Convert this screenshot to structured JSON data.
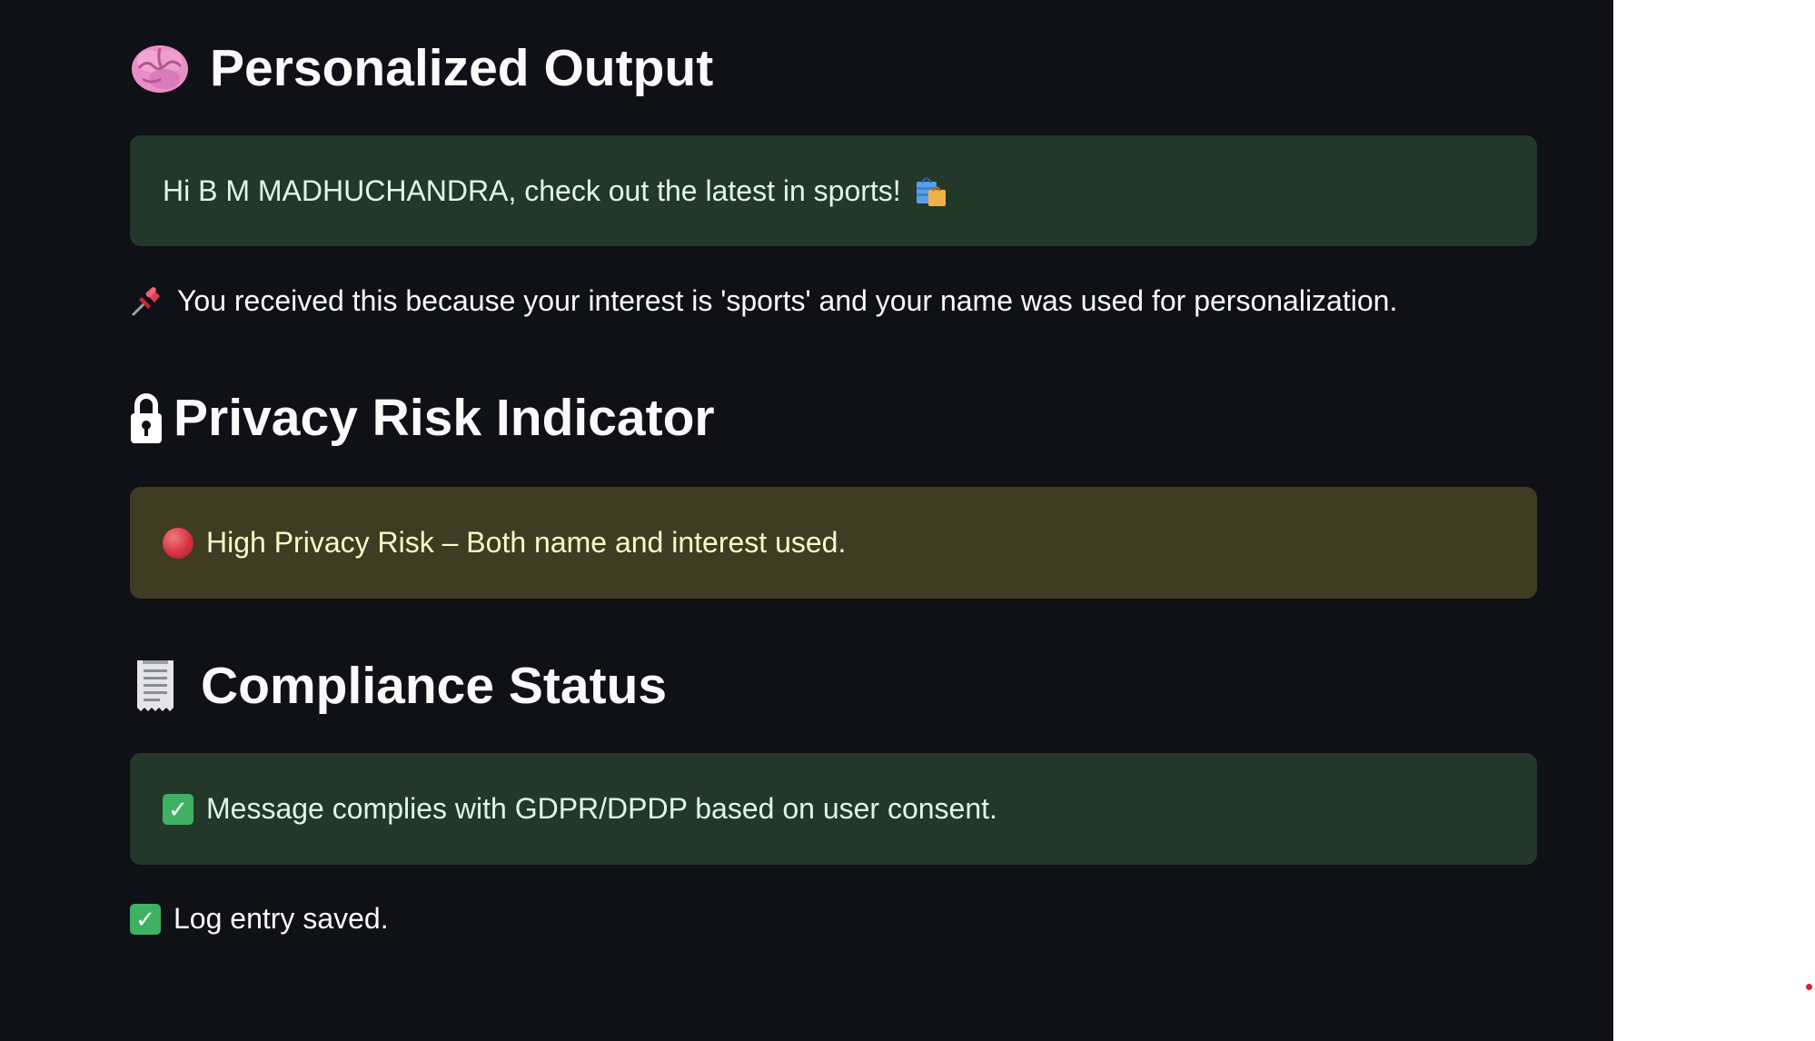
{
  "sections": {
    "personalized_output": {
      "heading": "Personalized Output",
      "icon": "brain-icon",
      "message": "Hi B M MADHUCHANDRA, check out the latest in sports!",
      "message_icon": "shopping-bags-icon",
      "explanation": "You received this because your interest is 'sports' and your name was used for personalization.",
      "explanation_icon": "pushpin-icon"
    },
    "privacy_risk": {
      "heading": "Privacy Risk Indicator",
      "icon": "lock-icon",
      "message": "High Privacy Risk – Both name and interest used.",
      "status_icon": "red-circle-icon"
    },
    "compliance": {
      "heading": "Compliance Status",
      "icon": "receipt-icon",
      "message": "Message complies with GDPR/DPDP based on user consent.",
      "status_icon": "check-mark-button-icon"
    },
    "log": {
      "message": "Log entry saved.",
      "status_icon": "check-mark-button-icon"
    }
  },
  "colors": {
    "app_background": "#0f1117",
    "success_background": "#24372b",
    "success_text": "#dff8e4",
    "warning_background": "#403b23",
    "warning_text": "#fffac8",
    "check_green": "#3fb163",
    "risk_red": "#d6323f"
  }
}
